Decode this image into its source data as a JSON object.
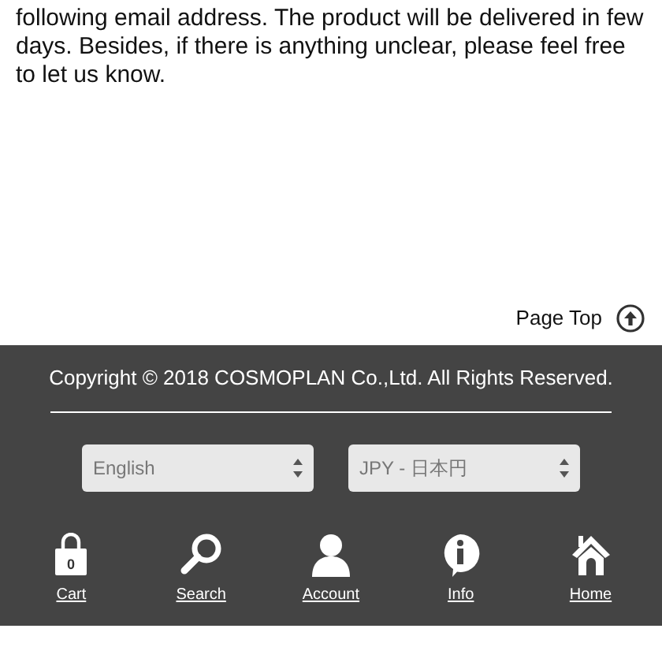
{
  "message": "following email address. The product will be delivered in few days. Besides, if there is anything unclear, please feel free to let us know.",
  "page_top": {
    "label": "Page Top"
  },
  "footer": {
    "copyright": "Copyright © 2018 COSMOPLAN Co.,Ltd. All Rights Reserved.",
    "selects": [
      {
        "value": "English"
      },
      {
        "value": "JPY - 日本円"
      }
    ],
    "nav": [
      {
        "kind": "cart",
        "label": "Cart",
        "count": "0"
      },
      {
        "kind": "search",
        "label": "Search"
      },
      {
        "kind": "account",
        "label": "Account"
      },
      {
        "kind": "info",
        "label": "Info"
      },
      {
        "kind": "home",
        "label": "Home"
      }
    ]
  }
}
